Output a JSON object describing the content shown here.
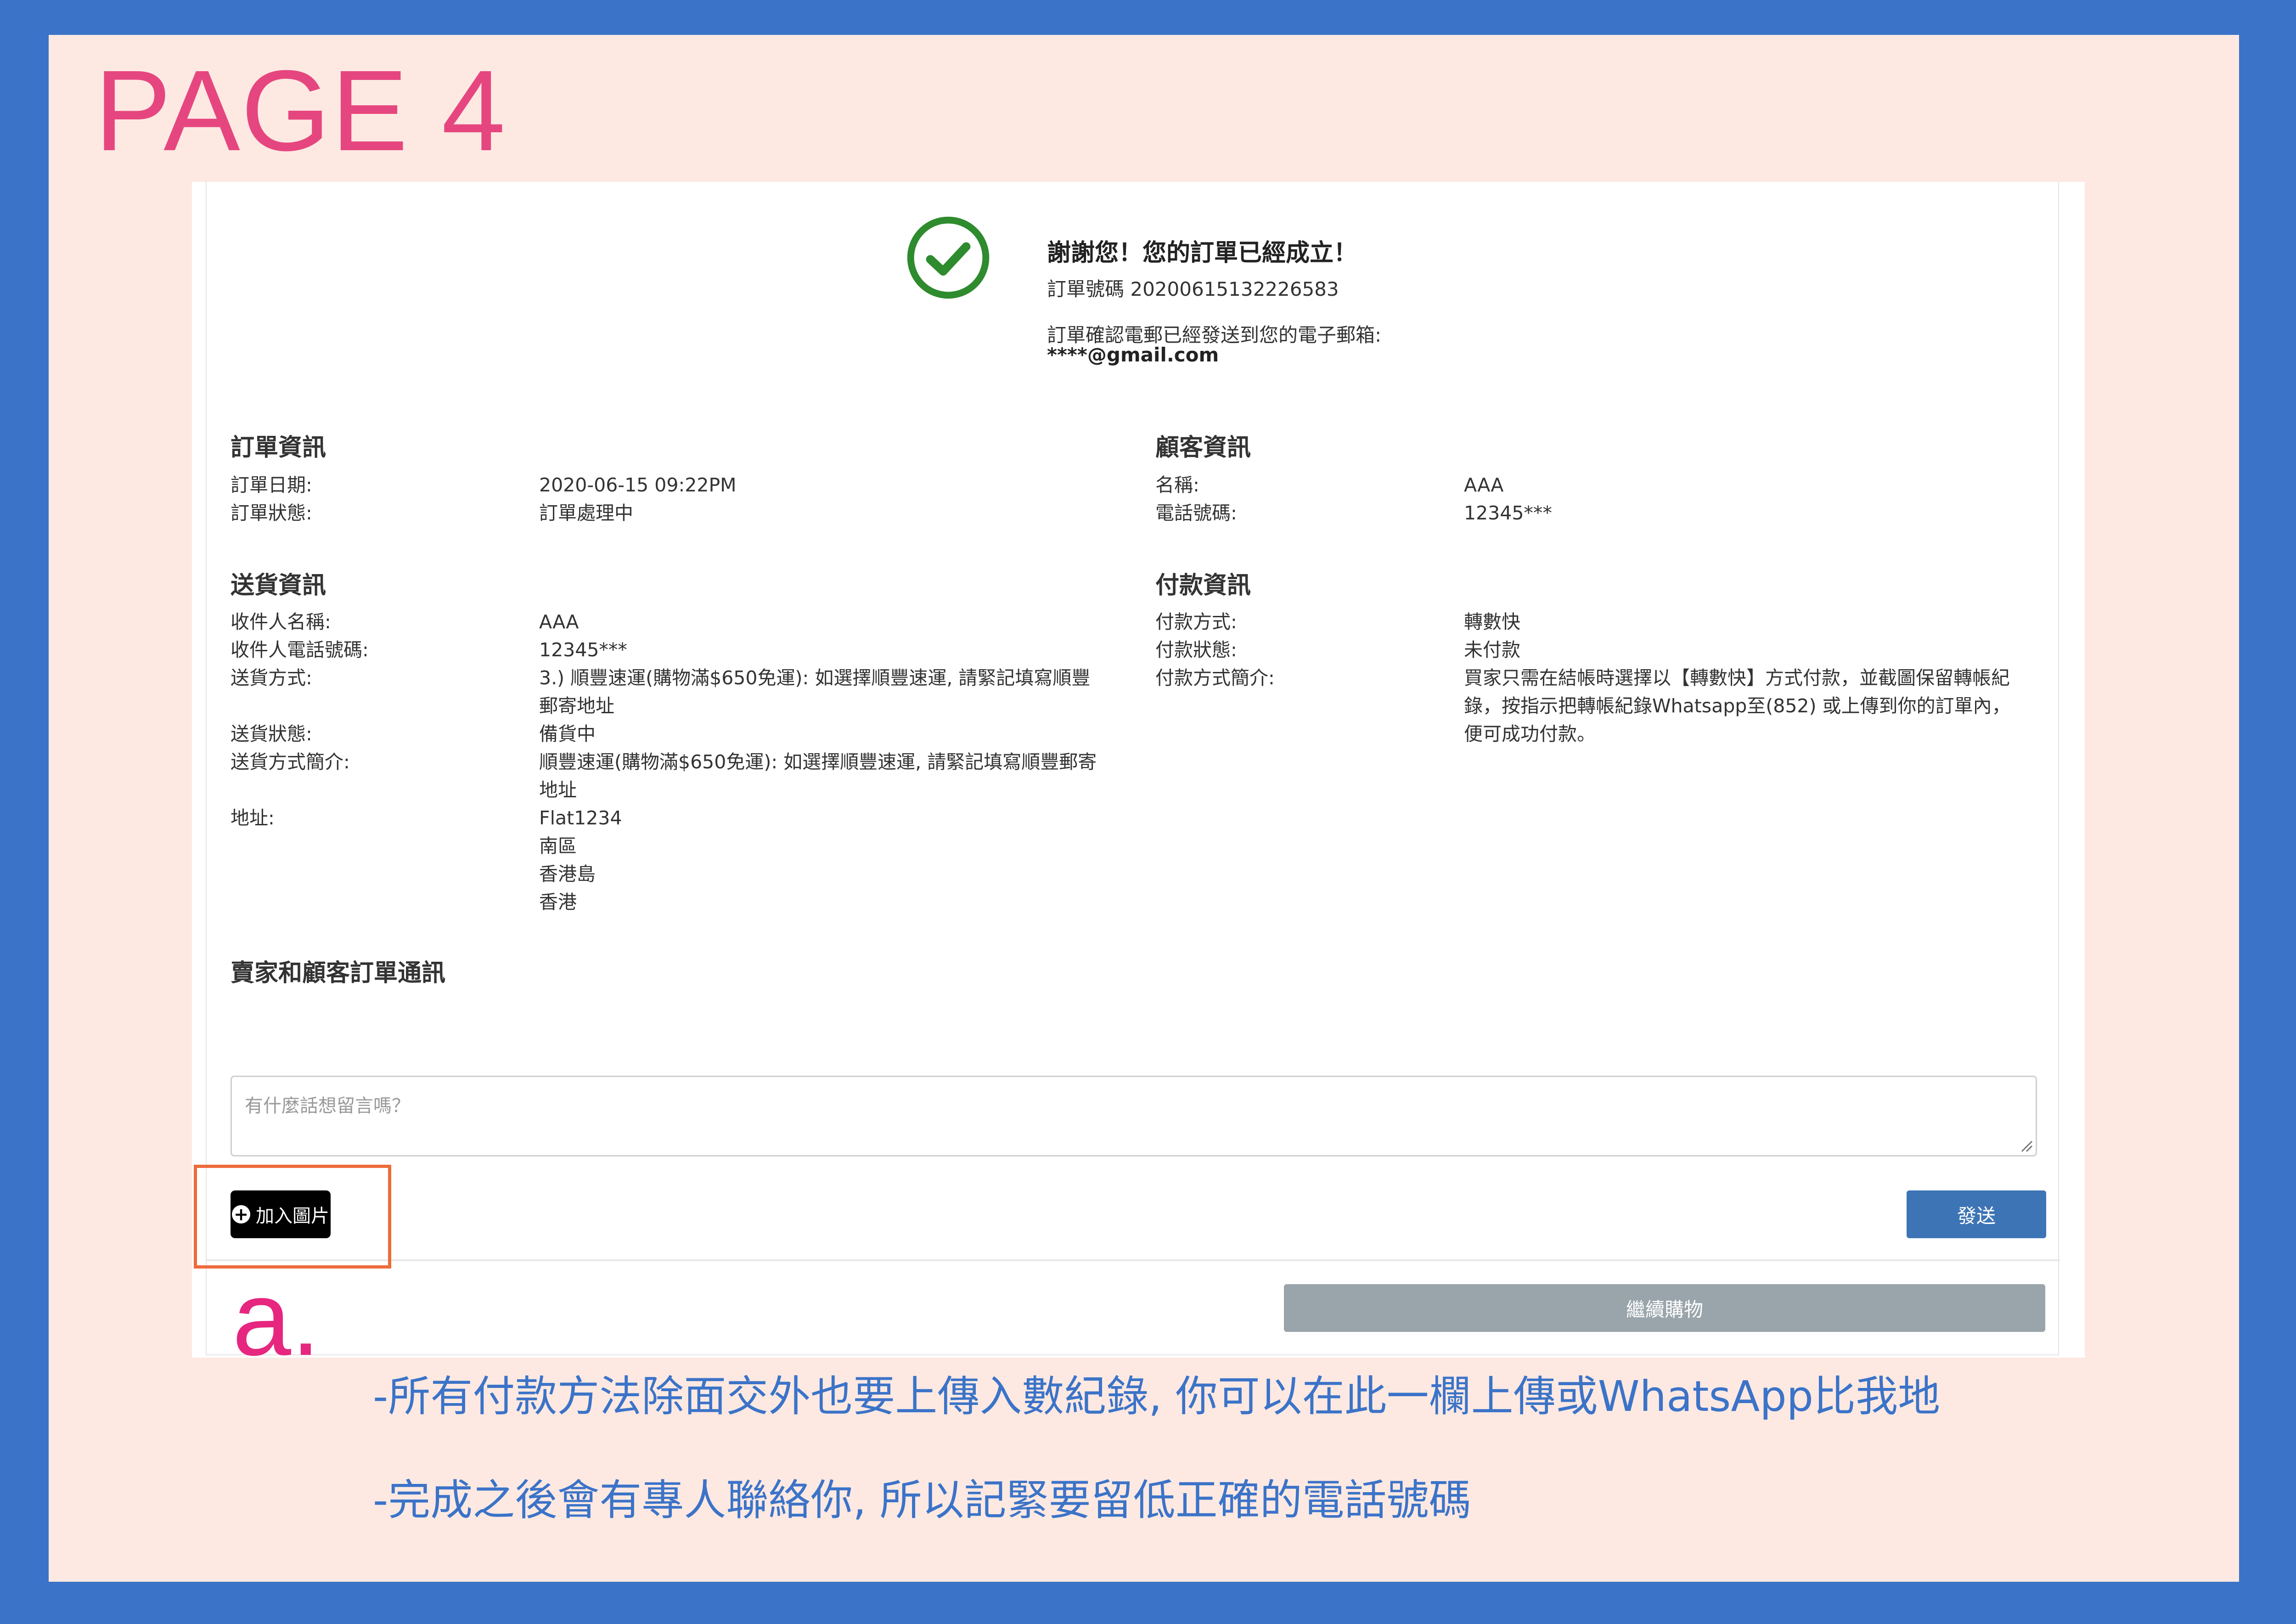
{
  "page_label": "PAGE 4",
  "confirmation": {
    "thanks": "謝謝您！您的訂單已經成立！",
    "order_number_line": "訂單號碼 20200615132226583",
    "email_note": "訂單確認電郵已經發送到您的電子郵箱:",
    "email": "****@gmail.com"
  },
  "order_info": {
    "heading": "訂單資訊",
    "rows": [
      {
        "label": "訂單日期:",
        "value": "2020-06-15 09:22PM"
      },
      {
        "label": "訂單狀態:",
        "value": "訂單處理中"
      }
    ]
  },
  "customer_info": {
    "heading": "顧客資訊",
    "rows": [
      {
        "label": "名稱:",
        "value": "AAA"
      },
      {
        "label": "電話號碼:",
        "value": "12345***"
      }
    ]
  },
  "delivery_info": {
    "heading": "送貨資訊",
    "rows": [
      {
        "label": "收件人名稱:",
        "value": "AAA"
      },
      {
        "label": "收件人電話號碼:",
        "value": "12345***"
      },
      {
        "label": "送貨方式:",
        "value": "3.) 順豐速運(購物滿$650免運): 如選擇順豐速運, 請緊記填寫順豐郵寄地址"
      },
      {
        "label": "送貨狀態:",
        "value": "備貨中"
      },
      {
        "label": "送貨方式簡介:",
        "value": "順豐速運(購物滿$650免運): 如選擇順豐速運, 請緊記填寫順豐郵寄地址"
      },
      {
        "label": "地址:",
        "lines": [
          "Flat1234",
          "南區",
          "香港島",
          "香港"
        ]
      }
    ]
  },
  "payment_info": {
    "heading": "付款資訊",
    "rows": [
      {
        "label": "付款方式:",
        "value": "轉數快"
      },
      {
        "label": "付款狀態:",
        "value": "未付款"
      },
      {
        "label": "付款方式簡介:",
        "value": "買家只需在結帳時選擇以【轉數快】方式付款，並截圖保留轉帳紀錄，按指示把轉帳紀錄Whatsapp至(852) 或上傳到你的訂單內，便可成功付款。"
      }
    ]
  },
  "messaging": {
    "heading": "賣家和顧客訂單通訊",
    "placeholder": "有什麼話想留言嗎？",
    "add_image_label": "加入圖片",
    "send_label": "發送"
  },
  "continue_label": "繼續購物",
  "annotation": {
    "marker": "a.",
    "note1": "-所有付款方法除面交外也要上傳入數紀錄, 你可以在此一欄上傳或WhatsApp比我地",
    "note2": "-完成之後會有專人聯絡你, 所以記緊要留低正確的電話號碼"
  },
  "colors": {
    "outer_border": "#3b73c8",
    "background": "#fde9e2",
    "page_label": "#e6467f",
    "check": "#2e8b2e",
    "highlight": "#ee6b3b",
    "send_button": "#3d74b5",
    "continue_button": "#9aa5ab",
    "note_text": "#3b73c8"
  }
}
